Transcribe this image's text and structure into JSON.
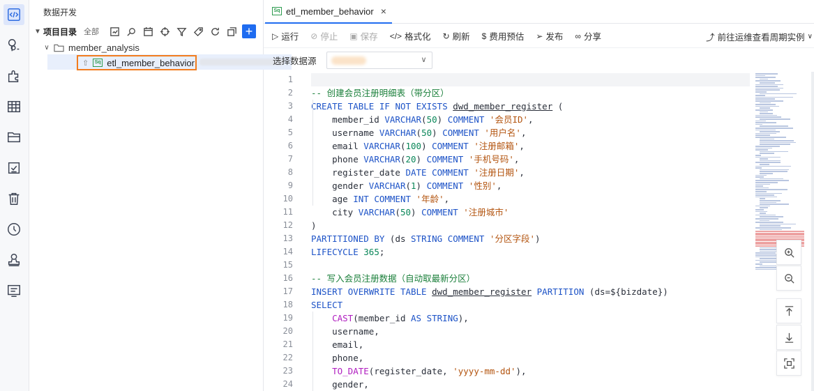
{
  "sidebar": {
    "title": "数据开发",
    "tree_header": "项目目录",
    "filter_label": "全部",
    "folder": "member_analysis",
    "file": "etl_member_behavior",
    "file_badge": "Sq"
  },
  "tab": {
    "label": "etl_member_behavior",
    "badge": "Sq",
    "close": "×"
  },
  "toolbar": {
    "run": "运行",
    "stop": "停止",
    "save": "保存",
    "format": "格式化",
    "refresh": "刷新",
    "estimate": "费用预估",
    "publish": "发布",
    "share": "分享",
    "ops_link": "前往运维查看周期实例"
  },
  "datasource": {
    "label": "选择数据源"
  },
  "code": {
    "lines": [
      "",
      "-- 创建会员注册明细表（带分区）",
      "CREATE TABLE IF NOT EXISTS dwd_member_register (",
      "    member_id VARCHAR(50) COMMENT '会员ID',",
      "    username VARCHAR(50) COMMENT '用户名',",
      "    email VARCHAR(100) COMMENT '注册邮箱',",
      "    phone VARCHAR(20) COMMENT '手机号码',",
      "    register_date DATE COMMENT '注册日期',",
      "    gender VARCHAR(1) COMMENT '性别',",
      "    age INT COMMENT '年龄',",
      "    city VARCHAR(50) COMMENT '注册城市'",
      ")",
      "PARTITIONED BY (ds STRING COMMENT '分区字段')",
      "LIFECYCLE 365;",
      "",
      "-- 写入会员注册数据（自动取最新分区）",
      "INSERT OVERWRITE TABLE dwd_member_register PARTITION (ds=${bizdate})",
      "SELECT",
      "    CAST(member_id AS STRING),",
      "    username,",
      "    email,",
      "    phone,",
      "    TO_DATE(register_date, 'yyyy-mm-dd'),",
      "    gender,"
    ]
  }
}
